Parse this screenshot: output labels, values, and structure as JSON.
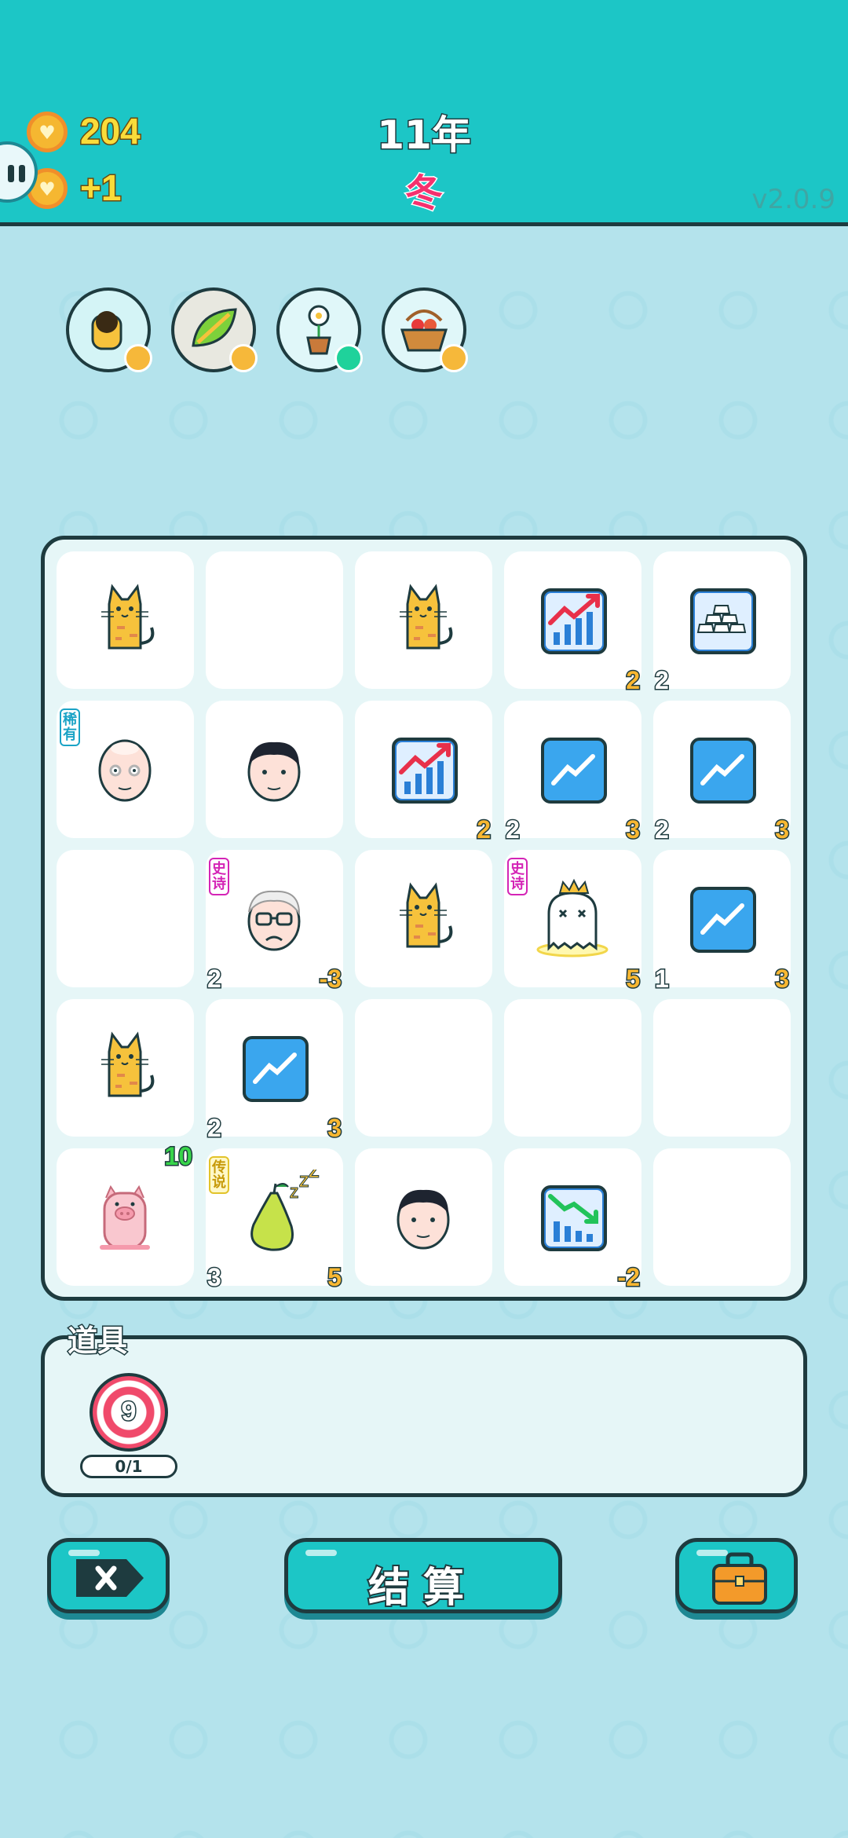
{
  "header": {
    "coins": "204",
    "coins_per_turn": "+1",
    "year": "11年",
    "season": "冬",
    "version": "v2.0.9"
  },
  "relics": [
    {
      "icon": "cat-relic-icon"
    },
    {
      "icon": "leaf-relic-icon"
    },
    {
      "icon": "flower-pot-relic-icon"
    },
    {
      "icon": "fruit-basket-relic-icon"
    }
  ],
  "board": {
    "cells": [
      {
        "icon": "cat-icon"
      },
      {
        "icon": ""
      },
      {
        "icon": "cat-icon"
      },
      {
        "icon": "bull-market-chart-icon",
        "right": "2"
      },
      {
        "icon": "gold-bars-icon",
        "left": "2"
      },
      {
        "icon": "bald-old-man-icon",
        "tag": "稀有"
      },
      {
        "icon": "man-face-icon"
      },
      {
        "icon": "bull-market-chart-icon",
        "right": "2"
      },
      {
        "icon": "stock-trend-icon",
        "left": "2",
        "right": "3"
      },
      {
        "icon": "stock-trend-icon",
        "left": "2",
        "right": "3"
      },
      {
        "icon": ""
      },
      {
        "icon": "grumpy-grandpa-icon",
        "tag": "史诗",
        "left": "2",
        "right": "-3"
      },
      {
        "icon": "cat-icon"
      },
      {
        "icon": "ghost-king-icon",
        "tag": "史诗",
        "right": "5"
      },
      {
        "icon": "stock-trend-icon",
        "left": "1",
        "right": "3"
      },
      {
        "icon": "cat-icon"
      },
      {
        "icon": "stock-trend-icon",
        "left": "2",
        "right": "3"
      },
      {
        "icon": ""
      },
      {
        "icon": ""
      },
      {
        "icon": ""
      },
      {
        "icon": "pig-icon",
        "top": "10"
      },
      {
        "icon": "sleeping-pear-icon",
        "tag": "传说",
        "left": "3",
        "right": "5"
      },
      {
        "icon": "man-face-icon"
      },
      {
        "icon": "bear-market-chart-icon",
        "right": "-2"
      },
      {
        "icon": ""
      }
    ]
  },
  "tools": {
    "label": "道具",
    "target_value": "9",
    "target_count": "0/1"
  },
  "buttons": {
    "settle": "结算"
  }
}
